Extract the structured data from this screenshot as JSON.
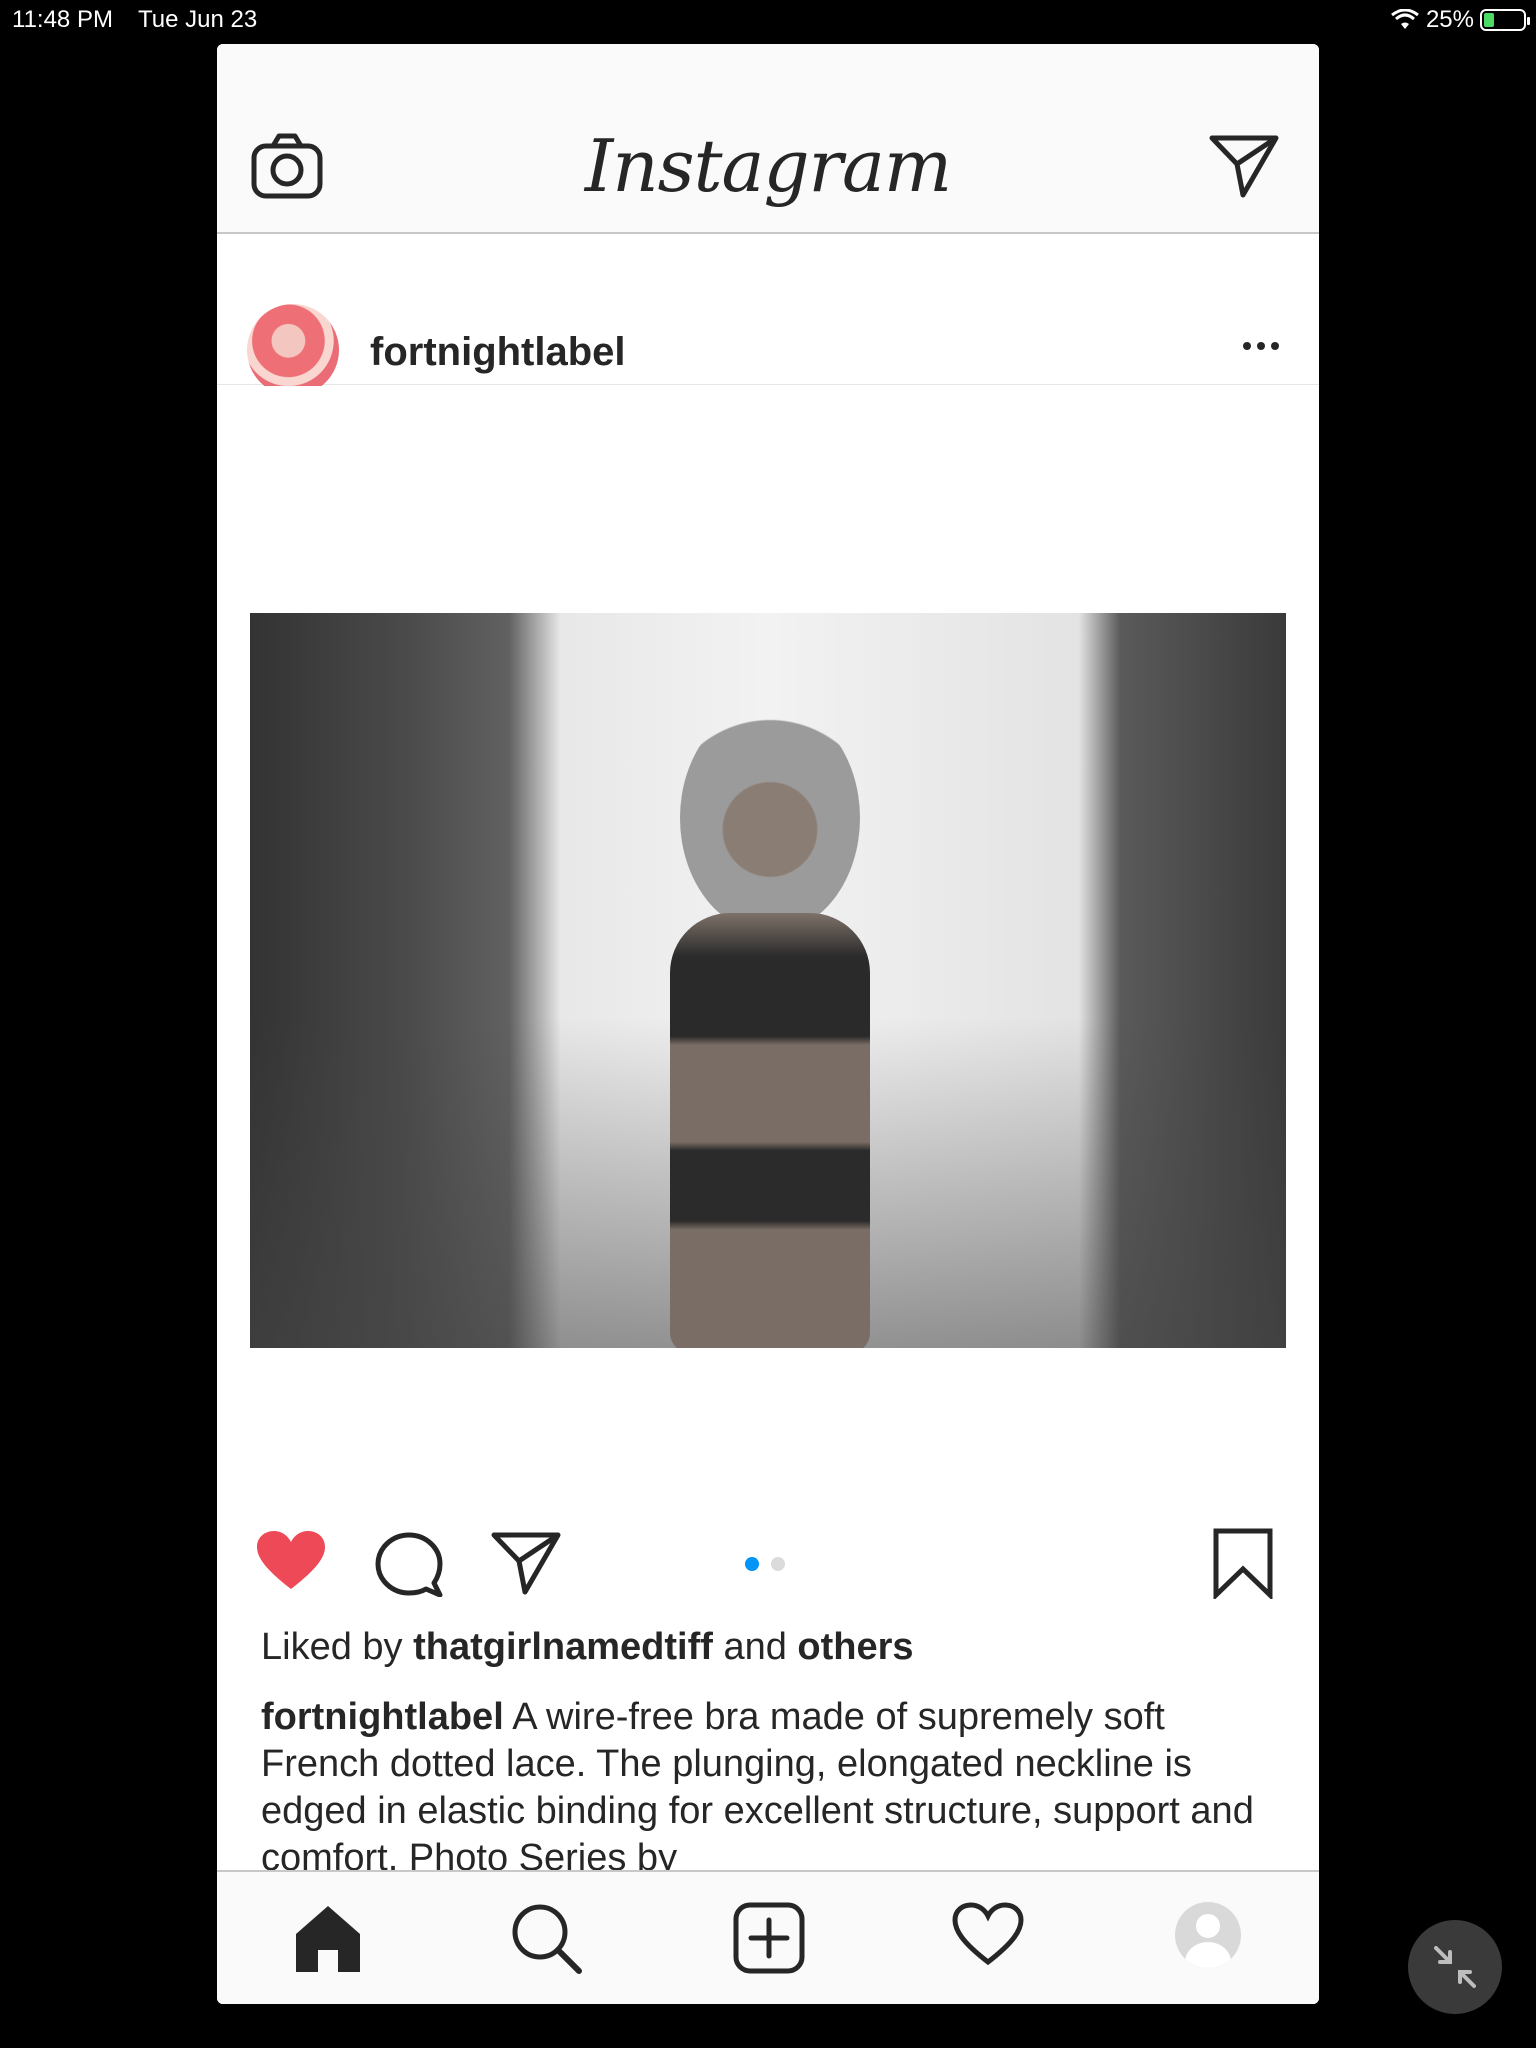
{
  "status_bar": {
    "time": "11:48 PM",
    "date": "Tue Jun 23",
    "battery": "25%"
  },
  "header": {
    "logo_text": "Instagram"
  },
  "post": {
    "username": "fortnightlabel",
    "likes": {
      "prefix": "Liked by",
      "user": "thatgirlnamedtiff",
      "middle": "and",
      "others": "others"
    },
    "caption": {
      "username": "fortnightlabel",
      "text": "A wire-free bra made of supremely soft French dotted lace. The plunging, elongated neckline is edged in elastic binding for excellent structure, support and comfort. Photo Series by"
    },
    "carousel": {
      "count": 2,
      "active": 1
    }
  },
  "colors": {
    "like_red": "#ed4956",
    "dot_active": "#0095f6",
    "dot_inactive": "#dbdbdb"
  },
  "icons": {
    "top_left": "camera-icon",
    "top_right": "direct-message-icon",
    "post_more": "more-options-icon",
    "actions": [
      "like-heart-icon",
      "comment-icon",
      "share-icon",
      "bookmark-icon"
    ],
    "tabs": [
      "home-icon",
      "search-icon",
      "add-post-icon",
      "activity-heart-icon",
      "profile-icon"
    ],
    "overlay": "minimize-icon"
  }
}
